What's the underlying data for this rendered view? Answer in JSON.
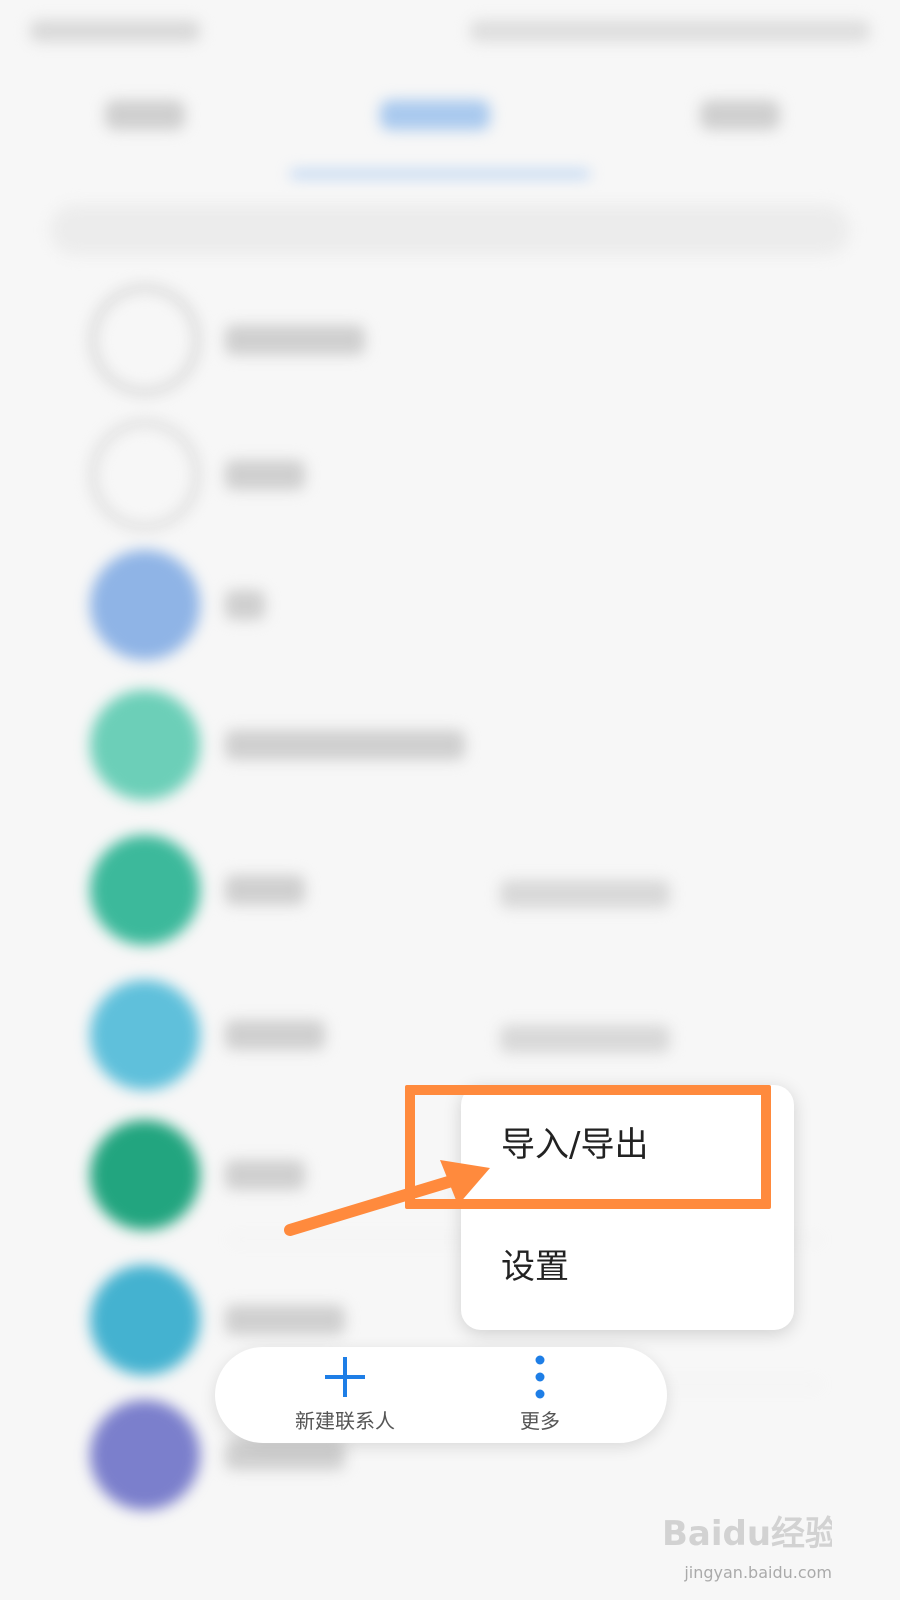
{
  "menu": {
    "items": [
      {
        "label": "导入/导出"
      },
      {
        "label": "设置"
      }
    ]
  },
  "bottom_bar": {
    "new_contact_label": "新建联系人",
    "more_label": "更多",
    "accent_color": "#1e7ee6"
  },
  "annotation": {
    "highlight_color": "#ff8a3d"
  },
  "watermark": {
    "brand": "Baidu经验",
    "url": "jingyan.baidu.com"
  },
  "icons": [
    "plus-icon",
    "more-vertical-icon"
  ]
}
